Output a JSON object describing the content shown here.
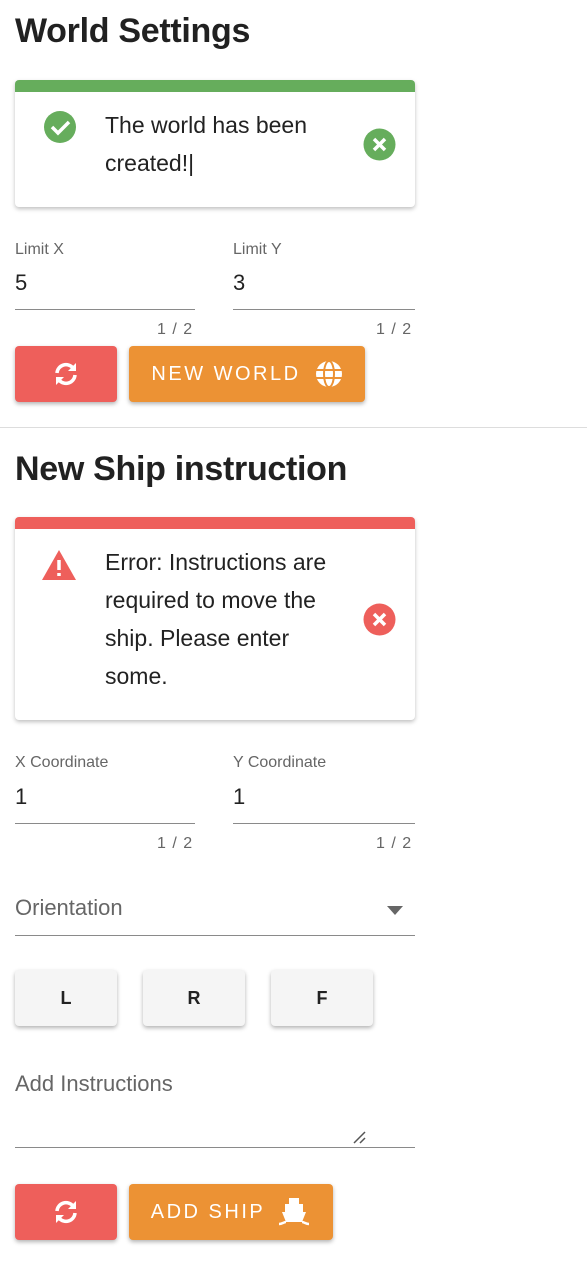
{
  "world": {
    "title": "World Settings",
    "alert": "The world has been created!|",
    "limit_x": {
      "label": "Limit X",
      "value": "5",
      "counter": "1 / 2"
    },
    "limit_y": {
      "label": "Limit Y",
      "value": "3",
      "counter": "1 / 2"
    },
    "new_world": "NEW WORLD"
  },
  "ship": {
    "title": "New Ship instruction",
    "alert": "Error: Instructions are required to move the ship. Please enter some.",
    "x": {
      "label": "X Coordinate",
      "value": "1",
      "counter": "1 / 2"
    },
    "y": {
      "label": "Y Coordinate",
      "value": "1",
      "counter": "1 / 2"
    },
    "orientation": "Orientation",
    "buttons": [
      "L",
      "R",
      "F"
    ],
    "instructions": "Add Instructions",
    "add_ship": "ADD SHIP"
  },
  "colors": {
    "success": "#66ad5c",
    "error": "#ee5f5b",
    "accent": "#ec9234"
  }
}
